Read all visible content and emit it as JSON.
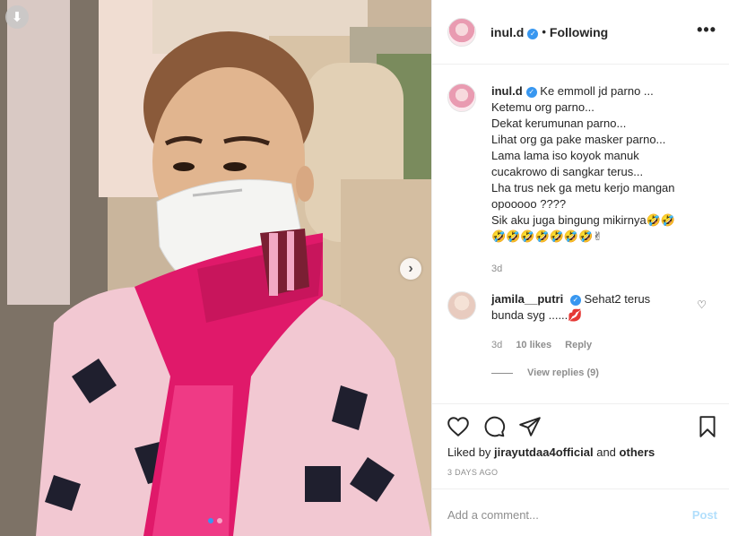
{
  "post": {
    "username": "inul.d",
    "follow_status": "Following",
    "separator": "•",
    "more_icon": "•••",
    "save_arrow": "⬇",
    "next_arrow": "›"
  },
  "caption": {
    "username": "inul.d",
    "lines": [
      "Ke emmoll jd parno ...",
      "Ketemu org parno...",
      "Dekat kerumunan parno...",
      "Lihat org ga pake masker parno...",
      "Lama lama iso koyok manuk",
      "cucakrowo di sangkar terus...",
      "Lha trus nek ga metu kerjo mangan",
      "opooooo ????",
      "Sik aku juga bingung mikirnya🤣🤣",
      "🤣🤣🤣🤣🤣🤣🤣✌"
    ],
    "time": "3d"
  },
  "comment": {
    "username": "jamila__putri",
    "text_line1": "Sehat2 terus",
    "text_line2": "bunda syg ......💋",
    "time": "3d",
    "likes": "10 likes",
    "reply": "Reply",
    "view_replies": "View replies (9)"
  },
  "engagement": {
    "liked_by_prefix": "Liked by",
    "liked_by_user": "jirayutdaa4official",
    "liked_by_and": "and",
    "liked_by_others": "others",
    "date": "3 DAYS AGO"
  },
  "composer": {
    "placeholder": "Add a comment...",
    "post_label": "Post"
  },
  "carousel": {
    "slides": 2,
    "active_index": 0
  },
  "colors": {
    "verified_blue": "#3897f0",
    "post_disabled": "#b2dffc",
    "muted": "#8e8e8e"
  }
}
